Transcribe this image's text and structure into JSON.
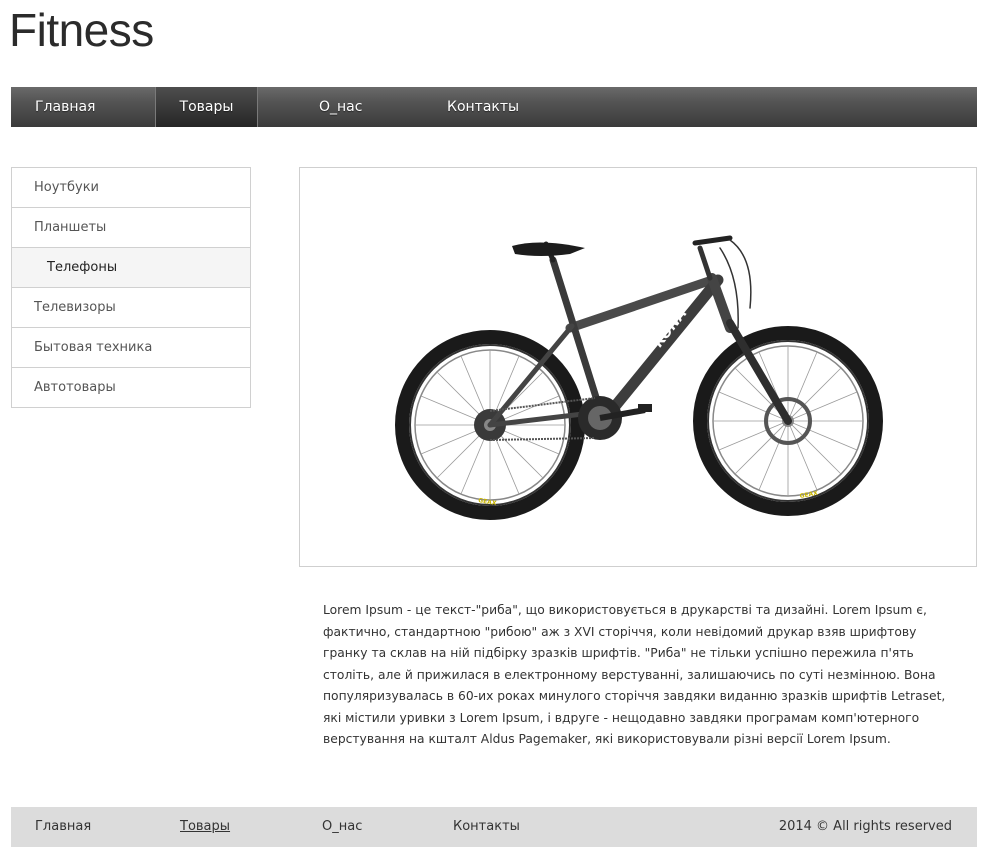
{
  "header": {
    "logo": "Fitness"
  },
  "nav": {
    "items": [
      {
        "label": "Главная"
      },
      {
        "label": "Товары",
        "active": true
      },
      {
        "label": "О_нас"
      },
      {
        "label": "Контакты"
      }
    ]
  },
  "sidebar": {
    "items": [
      {
        "label": "Ноутбуки"
      },
      {
        "label": "Планшеты"
      },
      {
        "label": "Телефоны",
        "active": true
      },
      {
        "label": "Телевизоры"
      },
      {
        "label": "Бытовая техника"
      },
      {
        "label": "Автотовары"
      }
    ]
  },
  "product": {
    "image_icon": "mountain-bicycle",
    "frame_brand_text": "KONA",
    "tire_brand_text": "GEAX"
  },
  "content": {
    "description": "Lorem Ipsum - це текст-\"риба\", що використовується в друкарстві та дизайні. Lorem Ipsum є, фактично, стандартною \"рибою\" аж з XVI сторіччя, коли невідомий друкар взяв шрифтову гранку та склав на ній підбірку зразків шрифтів. \"Риба\" не тільки успішно пережила п'ять століть, але й прижилася в електронному верстуванні, залишаючись по суті незмінною. Вона популяризувалась в 60-их роках минулого сторіччя завдяки виданню зразків шрифтів Letraset, які містили уривки з Lorem Ipsum, і вдруге - нещодавно завдяки програмам комп'ютерного верстування на кшталт Aldus Pagemaker, які використовували різні версії Lorem Ipsum."
  },
  "footer": {
    "items": [
      {
        "label": "Главная"
      },
      {
        "label": "Товары"
      },
      {
        "label": "О_нас"
      },
      {
        "label": "Контакты"
      }
    ],
    "copyright": "2014 © All rights reserved"
  },
  "colors": {
    "nav_bg": "#4a4a4a",
    "footer_bg": "#dcdcdc",
    "border": "#d0d0d0"
  }
}
